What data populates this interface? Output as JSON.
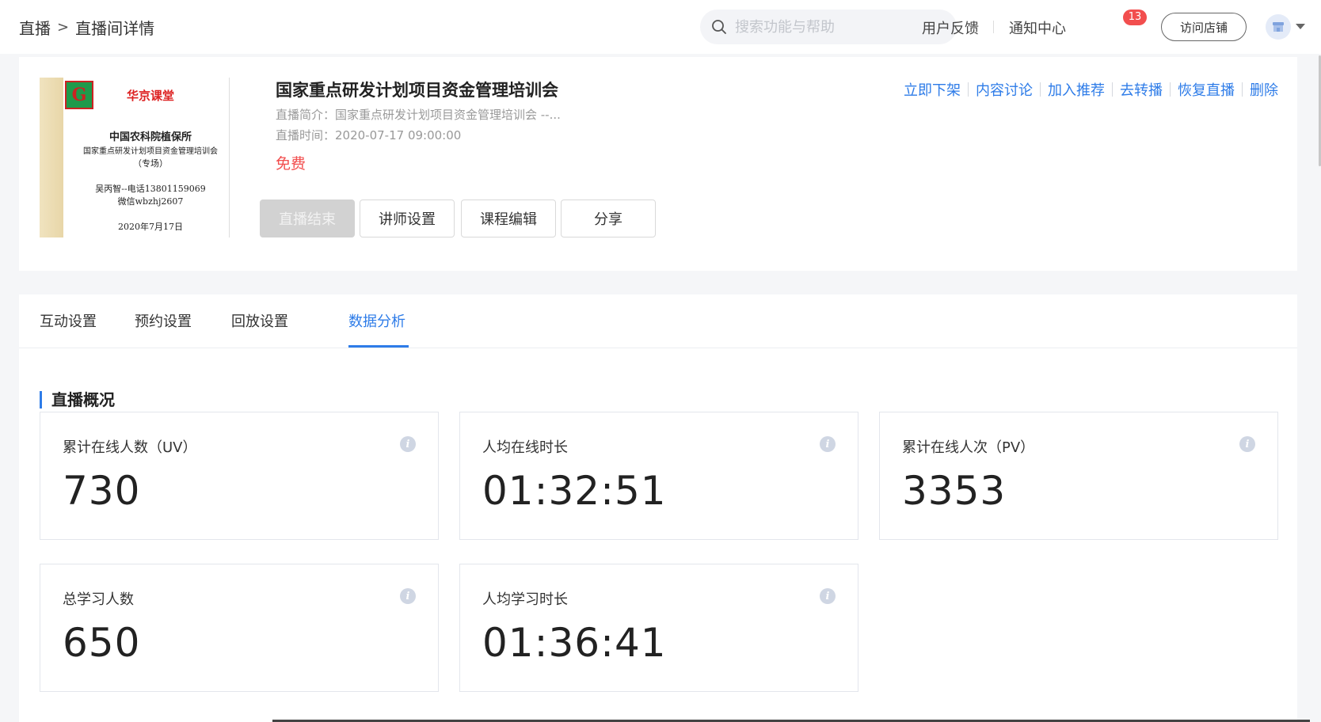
{
  "breadcrumb": {
    "root": "直播",
    "separator": ">",
    "current": "直播间详情"
  },
  "search": {
    "placeholder": "搜索功能与帮助"
  },
  "header_links": {
    "feedback": "用户反馈",
    "notifications": "通知中心",
    "notification_count": "13",
    "visit_store": "访问店铺"
  },
  "course": {
    "cover": {
      "brand": "华京课堂",
      "line1": "中国农科院植保所",
      "line2": "国家重点研发计划项目资金管理培训会",
      "line3": "（专场）",
      "line4": "吴丙智--电话13801159069",
      "line5": "微信wbzhj2607",
      "line6": "2020年7月17日"
    },
    "title": "国家重点研发计划项目资金管理培训会",
    "intro": "直播简介：国家重点研发计划项目资金管理培训会 --...",
    "time": "直播时间：2020-07-17 09:00:00",
    "price": "免费"
  },
  "buttons": {
    "ended": "直播结束",
    "teacher": "讲师设置",
    "edit": "课程编辑",
    "share": "分享"
  },
  "actions": [
    "立即下架",
    "内容讨论",
    "加入推荐",
    "去转播",
    "恢复直播",
    "删除"
  ],
  "tabs": [
    "互动设置",
    "预约设置",
    "回放设置",
    "数据分析"
  ],
  "active_tab": "数据分析",
  "section_title": "直播概况",
  "stats": [
    {
      "label": "累计在线人数（UV）",
      "value": "730"
    },
    {
      "label": "人均在线时长",
      "value": "01:32:51"
    },
    {
      "label": "累计在线人次（PV）",
      "value": "3353"
    },
    {
      "label": "总学习人数",
      "value": "650"
    },
    {
      "label": "人均学习时长",
      "value": "01:36:41"
    }
  ],
  "colors": {
    "accent": "#2e7ce8",
    "price": "#f24e4e",
    "badge": "#f24e4e"
  }
}
